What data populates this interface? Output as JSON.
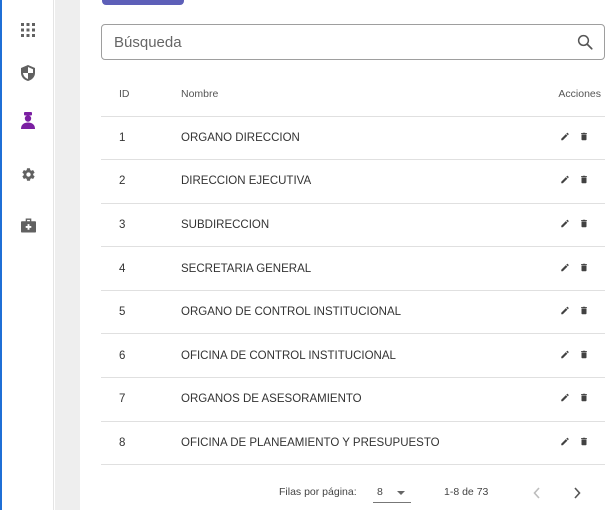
{
  "search": {
    "placeholder": "Búsqueda",
    "value": ""
  },
  "table": {
    "headers": {
      "id": "ID",
      "name": "Nombre",
      "actions": "Acciones"
    },
    "rows": [
      {
        "id": "1",
        "name": "ORGANO DIRECCION"
      },
      {
        "id": "2",
        "name": "DIRECCION EJECUTIVA"
      },
      {
        "id": "3",
        "name": "SUBDIRECCION"
      },
      {
        "id": "4",
        "name": "SECRETARIA GENERAL"
      },
      {
        "id": "5",
        "name": "ORGANO DE CONTROL INSTITUCIONAL"
      },
      {
        "id": "6",
        "name": "OFICINA DE CONTROL INSTITUCIONAL"
      },
      {
        "id": "7",
        "name": "ORGANOS DE ASESORAMIENTO"
      },
      {
        "id": "8",
        "name": "OFICINA DE PLANEAMIENTO Y PRESUPUESTO"
      }
    ]
  },
  "pagination": {
    "rows_label": "Filas por página:",
    "rows_per_page": "8",
    "range": "1-8 de 73"
  },
  "sidebar": {
    "items": [
      {
        "icon": "apps-grid-icon"
      },
      {
        "icon": "shield-icon"
      },
      {
        "icon": "user-badge-icon",
        "active": true
      },
      {
        "icon": "gear-icon"
      },
      {
        "icon": "medical-bag-icon"
      }
    ]
  },
  "colors": {
    "accent": "#5d5fb8",
    "active_icon": "#7b1fa2",
    "icon": "#616161",
    "frame_border": "#1f6fd6"
  }
}
